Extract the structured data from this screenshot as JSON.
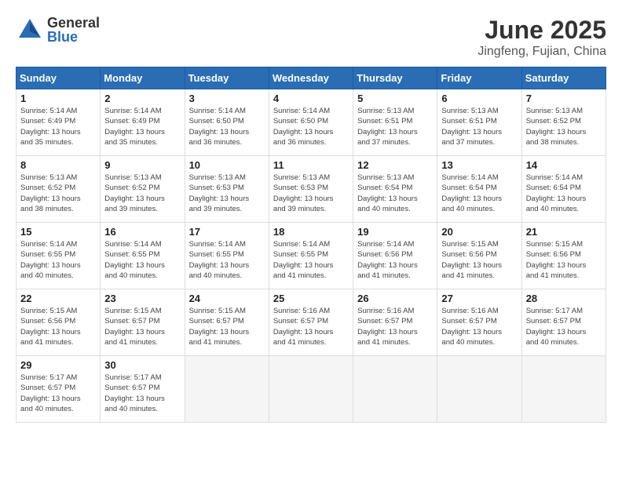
{
  "header": {
    "logo_general": "General",
    "logo_blue": "Blue",
    "month_title": "June 2025",
    "location": "Jingfeng, Fujian, China"
  },
  "days_of_week": [
    "Sunday",
    "Monday",
    "Tuesday",
    "Wednesday",
    "Thursday",
    "Friday",
    "Saturday"
  ],
  "days": [
    {
      "num": "1",
      "sunrise": "5:14 AM",
      "sunset": "6:49 PM",
      "daylight": "13 hours and 35 minutes."
    },
    {
      "num": "2",
      "sunrise": "5:14 AM",
      "sunset": "6:49 PM",
      "daylight": "13 hours and 35 minutes."
    },
    {
      "num": "3",
      "sunrise": "5:14 AM",
      "sunset": "6:50 PM",
      "daylight": "13 hours and 36 minutes."
    },
    {
      "num": "4",
      "sunrise": "5:14 AM",
      "sunset": "6:50 PM",
      "daylight": "13 hours and 36 minutes."
    },
    {
      "num": "5",
      "sunrise": "5:13 AM",
      "sunset": "6:51 PM",
      "daylight": "13 hours and 37 minutes."
    },
    {
      "num": "6",
      "sunrise": "5:13 AM",
      "sunset": "6:51 PM",
      "daylight": "13 hours and 37 minutes."
    },
    {
      "num": "7",
      "sunrise": "5:13 AM",
      "sunset": "6:52 PM",
      "daylight": "13 hours and 38 minutes."
    },
    {
      "num": "8",
      "sunrise": "5:13 AM",
      "sunset": "6:52 PM",
      "daylight": "13 hours and 38 minutes."
    },
    {
      "num": "9",
      "sunrise": "5:13 AM",
      "sunset": "6:52 PM",
      "daylight": "13 hours and 39 minutes."
    },
    {
      "num": "10",
      "sunrise": "5:13 AM",
      "sunset": "6:53 PM",
      "daylight": "13 hours and 39 minutes."
    },
    {
      "num": "11",
      "sunrise": "5:13 AM",
      "sunset": "6:53 PM",
      "daylight": "13 hours and 39 minutes."
    },
    {
      "num": "12",
      "sunrise": "5:13 AM",
      "sunset": "6:54 PM",
      "daylight": "13 hours and 40 minutes."
    },
    {
      "num": "13",
      "sunrise": "5:14 AM",
      "sunset": "6:54 PM",
      "daylight": "13 hours and 40 minutes."
    },
    {
      "num": "14",
      "sunrise": "5:14 AM",
      "sunset": "6:54 PM",
      "daylight": "13 hours and 40 minutes."
    },
    {
      "num": "15",
      "sunrise": "5:14 AM",
      "sunset": "6:55 PM",
      "daylight": "13 hours and 40 minutes."
    },
    {
      "num": "16",
      "sunrise": "5:14 AM",
      "sunset": "6:55 PM",
      "daylight": "13 hours and 40 minutes."
    },
    {
      "num": "17",
      "sunrise": "5:14 AM",
      "sunset": "6:55 PM",
      "daylight": "13 hours and 40 minutes."
    },
    {
      "num": "18",
      "sunrise": "5:14 AM",
      "sunset": "6:55 PM",
      "daylight": "13 hours and 41 minutes."
    },
    {
      "num": "19",
      "sunrise": "5:14 AM",
      "sunset": "6:56 PM",
      "daylight": "13 hours and 41 minutes."
    },
    {
      "num": "20",
      "sunrise": "5:15 AM",
      "sunset": "6:56 PM",
      "daylight": "13 hours and 41 minutes."
    },
    {
      "num": "21",
      "sunrise": "5:15 AM",
      "sunset": "6:56 PM",
      "daylight": "13 hours and 41 minutes."
    },
    {
      "num": "22",
      "sunrise": "5:15 AM",
      "sunset": "6:56 PM",
      "daylight": "13 hours and 41 minutes."
    },
    {
      "num": "23",
      "sunrise": "5:15 AM",
      "sunset": "6:57 PM",
      "daylight": "13 hours and 41 minutes."
    },
    {
      "num": "24",
      "sunrise": "5:15 AM",
      "sunset": "6:57 PM",
      "daylight": "13 hours and 41 minutes."
    },
    {
      "num": "25",
      "sunrise": "5:16 AM",
      "sunset": "6:57 PM",
      "daylight": "13 hours and 41 minutes."
    },
    {
      "num": "26",
      "sunrise": "5:16 AM",
      "sunset": "6:57 PM",
      "daylight": "13 hours and 41 minutes."
    },
    {
      "num": "27",
      "sunrise": "5:16 AM",
      "sunset": "6:57 PM",
      "daylight": "13 hours and 40 minutes."
    },
    {
      "num": "28",
      "sunrise": "5:17 AM",
      "sunset": "6:57 PM",
      "daylight": "13 hours and 40 minutes."
    },
    {
      "num": "29",
      "sunrise": "5:17 AM",
      "sunset": "6:57 PM",
      "daylight": "13 hours and 40 minutes."
    },
    {
      "num": "30",
      "sunrise": "5:17 AM",
      "sunset": "6:57 PM",
      "daylight": "13 hours and 40 minutes."
    }
  ]
}
